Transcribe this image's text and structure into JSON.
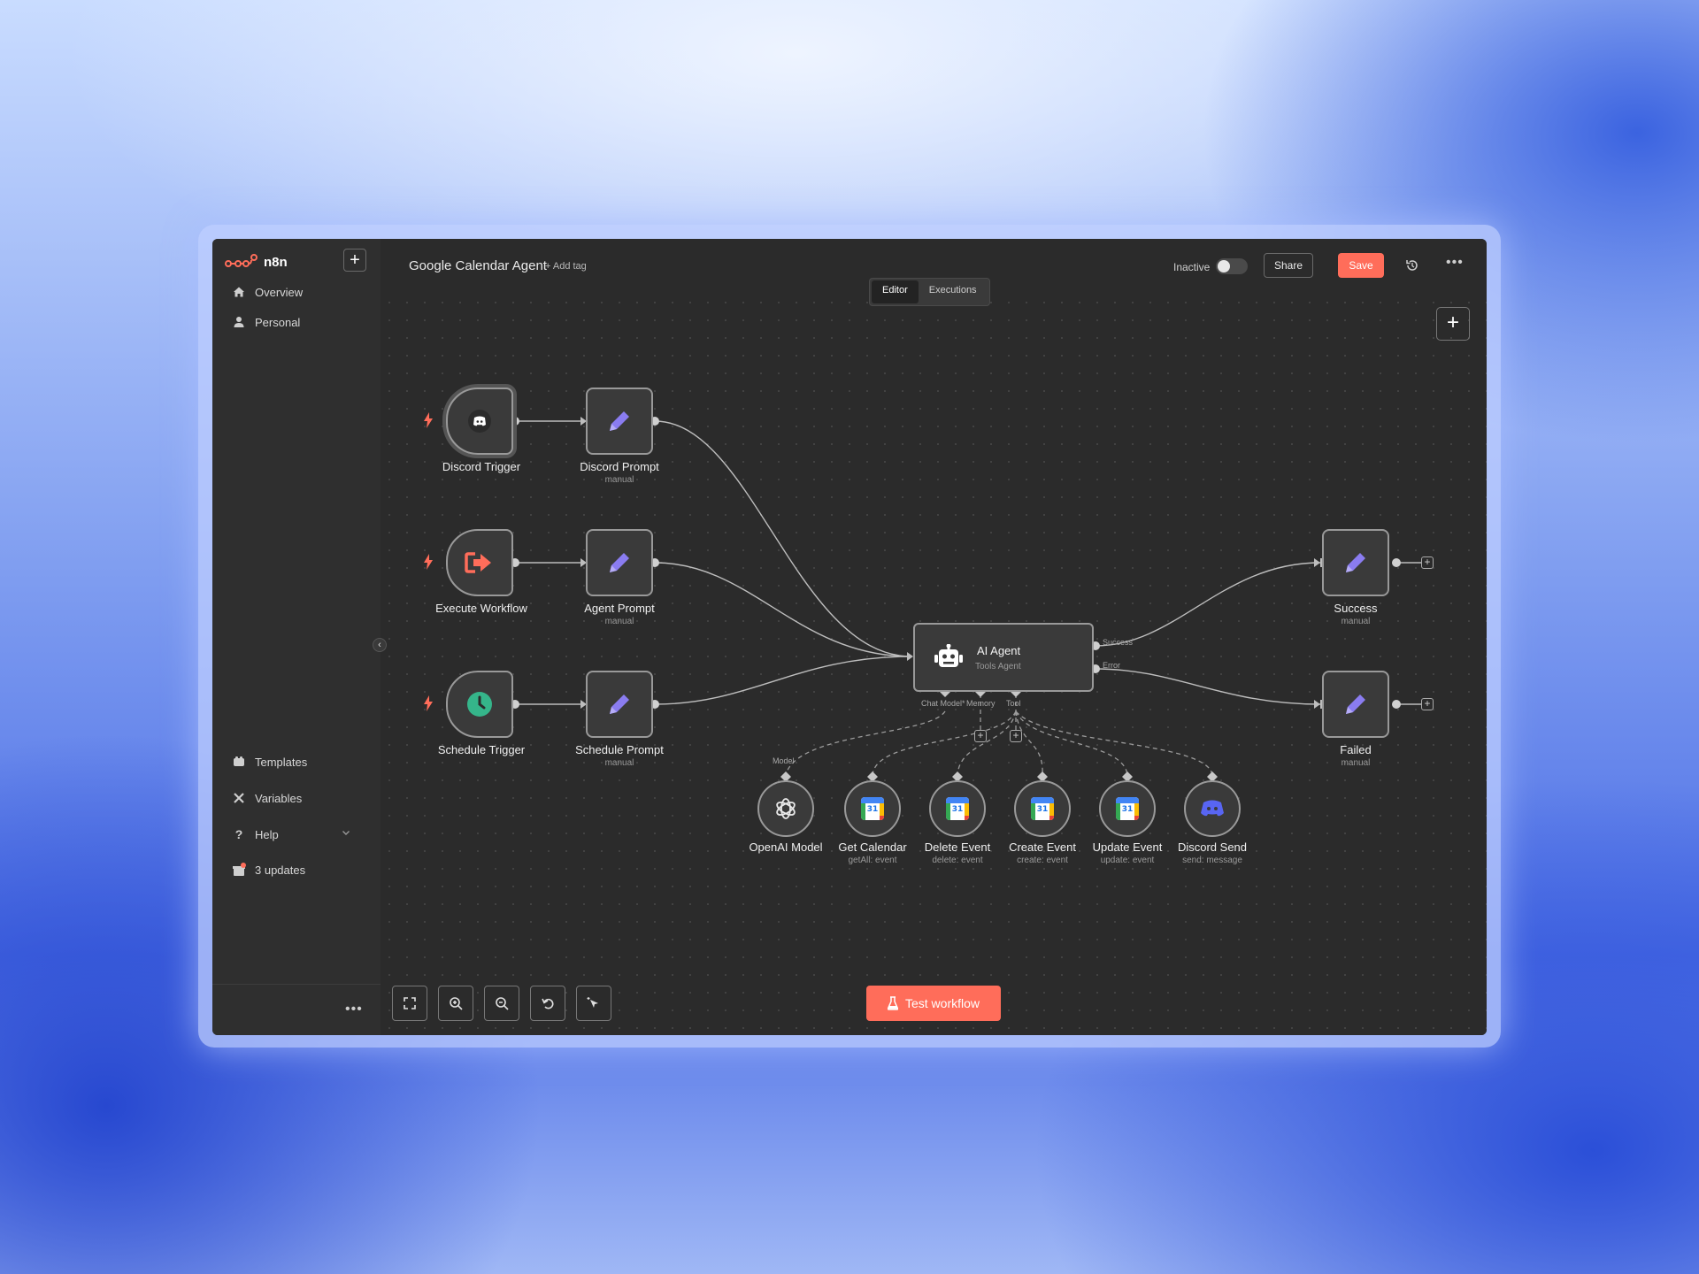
{
  "app": {
    "name": "n8n",
    "workflow_title": "Google Calendar Agent",
    "add_tag": "+ Add tag"
  },
  "sidebar": {
    "items": [
      {
        "label": "Overview",
        "icon": "home-icon"
      },
      {
        "label": "Personal",
        "icon": "user-icon"
      }
    ],
    "bottom_items": [
      {
        "label": "Templates",
        "icon": "templates-icon"
      },
      {
        "label": "Variables",
        "icon": "variables-icon"
      },
      {
        "label": "Help",
        "icon": "help-icon"
      },
      {
        "label": "3 updates",
        "icon": "gift-icon"
      }
    ],
    "more": "•••"
  },
  "header": {
    "status": "Inactive",
    "share_label": "Share",
    "save_label": "Save",
    "tabs": [
      {
        "label": "Editor",
        "active": true
      },
      {
        "label": "Executions",
        "active": false
      }
    ]
  },
  "nodes": {
    "discord_trigger": {
      "label": "Discord Trigger"
    },
    "discord_prompt": {
      "label": "Discord Prompt",
      "sub": "manual"
    },
    "execute_workflow": {
      "label": "Execute Workflow"
    },
    "agent_prompt": {
      "label": "Agent Prompt",
      "sub": "manual"
    },
    "schedule_trigger": {
      "label": "Schedule Trigger"
    },
    "schedule_prompt": {
      "label": "Schedule Prompt",
      "sub": "manual"
    },
    "ai_agent": {
      "label": "AI Agent",
      "sub": "Tools Agent"
    },
    "success": {
      "label": "Success",
      "sub": "manual"
    },
    "failed": {
      "label": "Failed",
      "sub": "manual"
    }
  },
  "ports": {
    "success": "Success",
    "error": "Error",
    "chat_model": "Chat Model*",
    "memory": "Memory",
    "tool": "Tool",
    "model": "Model"
  },
  "tools": [
    {
      "label": "OpenAI Model",
      "sub": ""
    },
    {
      "label": "Get Calendar",
      "sub": "getAll: event"
    },
    {
      "label": "Delete Event",
      "sub": "delete: event"
    },
    {
      "label": "Create Event",
      "sub": "create: event"
    },
    {
      "label": "Update Event",
      "sub": "update: event"
    },
    {
      "label": "Discord Send",
      "sub": "send: message"
    }
  ],
  "calendar_icon_number": "31",
  "toolbar": {
    "test_label": "Test workflow"
  },
  "colors": {
    "accent": "#ff6d5a",
    "node_border": "#999999",
    "pencil": "#8a7cf0",
    "clock": "#35b58a",
    "discord": "#5865f2"
  }
}
